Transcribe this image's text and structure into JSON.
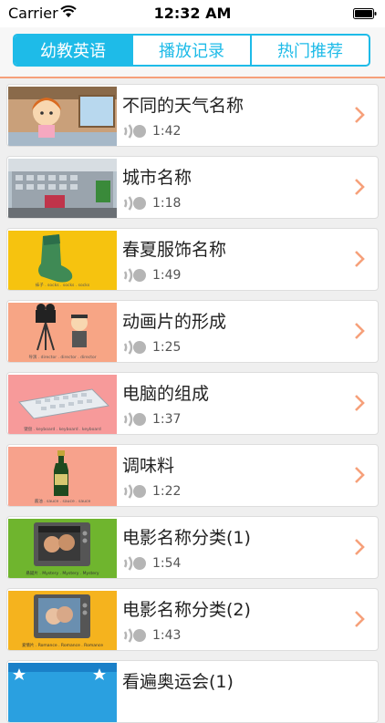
{
  "status_bar": {
    "carrier": "Carrier",
    "time": "12:32 AM"
  },
  "tabs": [
    {
      "label": "幼教英语",
      "active": true
    },
    {
      "label": "播放记录",
      "active": false
    },
    {
      "label": "热门推荐",
      "active": false
    }
  ],
  "colors": {
    "accent": "#1ebbe8",
    "header_rule": "#f6a07a",
    "chevron": "#f6a07a"
  },
  "items": [
    {
      "title": "不同的天气名称",
      "duration": "1:42",
      "thumb_icon": "girl-rain-cartoon-icon"
    },
    {
      "title": "城市名称",
      "duration": "1:18",
      "thumb_icon": "city-building-icon"
    },
    {
      "title": "春夏服饰名称",
      "duration": "1:49",
      "thumb_icon": "sock-icon",
      "thumb_caption": "袜子 . socks . socks . socks"
    },
    {
      "title": "动画片的形成",
      "duration": "1:25",
      "thumb_icon": "director-camera-icon",
      "thumb_caption": "导演 . director . director . director"
    },
    {
      "title": "电脑的组成",
      "duration": "1:37",
      "thumb_icon": "keyboard-icon",
      "thumb_caption": "键盘 . keyboard . keyboard . keyboard"
    },
    {
      "title": "调味料",
      "duration": "1:22",
      "thumb_icon": "sauce-bottle-icon",
      "thumb_caption": "酱油 . sauce . sauce . sauce"
    },
    {
      "title": "电影名称分类(1)",
      "duration": "1:54",
      "thumb_icon": "tv-movie-icon",
      "thumb_caption": "悬疑片 . Mystery . Mystery . Mystery"
    },
    {
      "title": "电影名称分类(2)",
      "duration": "1:43",
      "thumb_icon": "tv-movie-icon",
      "thumb_caption": "爱情片 . Romance . Romance . Romance"
    },
    {
      "title": "看遍奥运会(1)",
      "duration": "",
      "thumb_icon": "olympics-icon"
    }
  ]
}
